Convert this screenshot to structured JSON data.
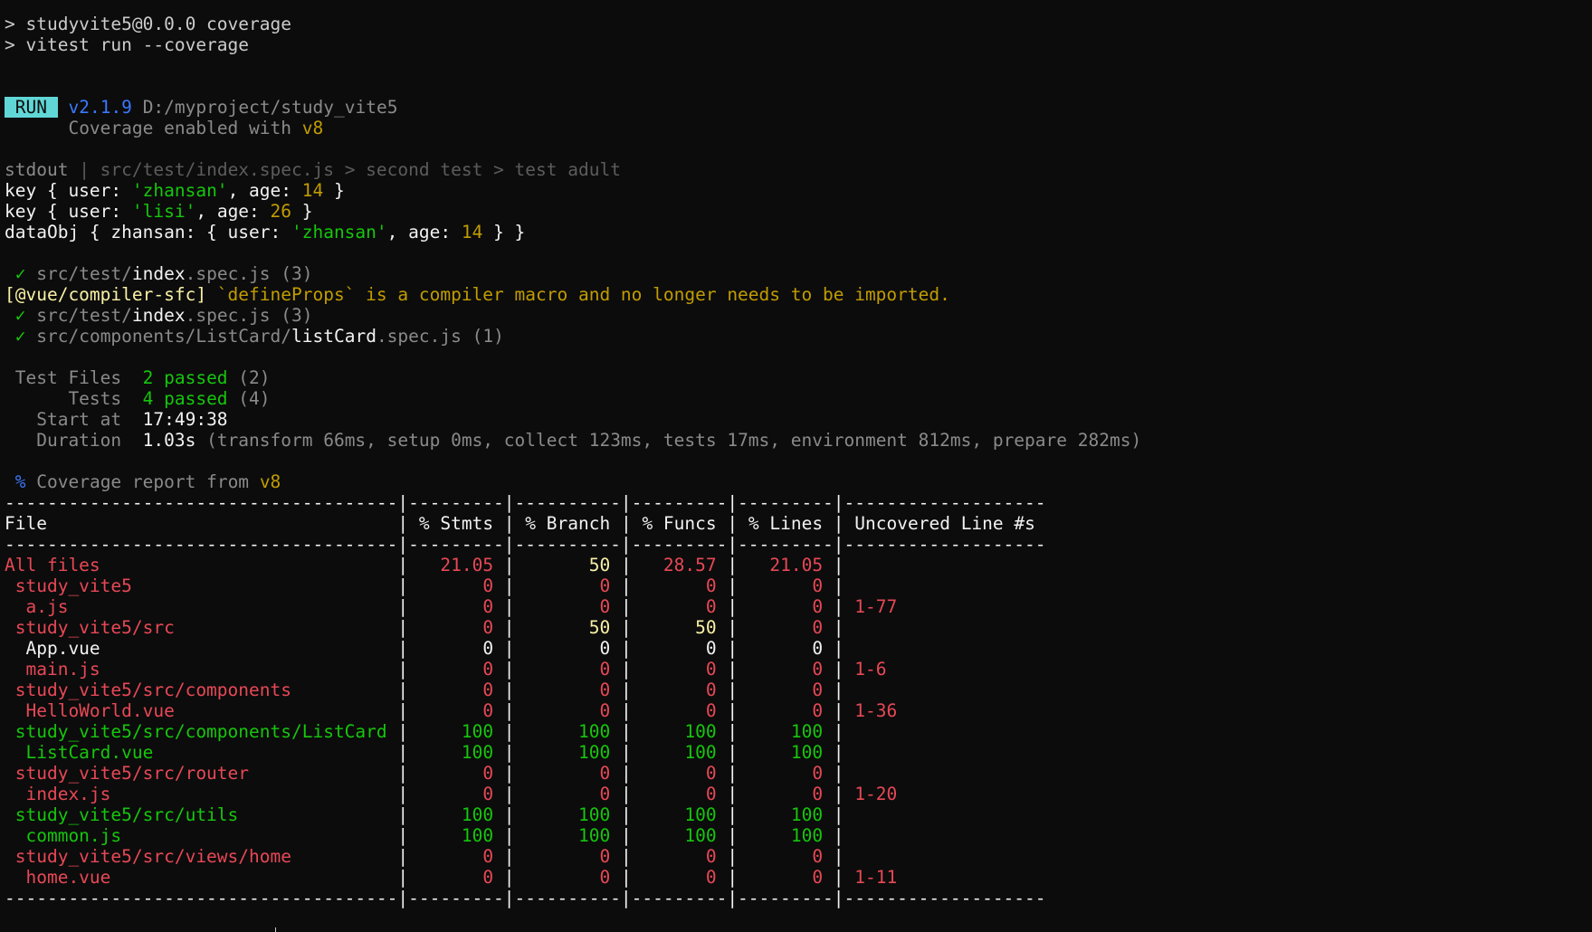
{
  "colors": {
    "background": "#0c0c0c",
    "default": "#cccccc",
    "red": "#e74856",
    "green": "#16c60c",
    "yellow": "#c19c00",
    "bright_yellow": "#f9f1a5",
    "blue": "#3b78ff",
    "badge": "#61d6d6"
  },
  "cmd": {
    "line1": "> studyvite5@0.0.0 coverage",
    "line2": "> vitest run --coverage"
  },
  "run": {
    "badge": "RUN",
    "version": "v2.1.9",
    "path": "D:/myproject/study_vite5",
    "coverage_text": "Coverage enabled with",
    "coverage_provider": "v8"
  },
  "stdout": {
    "label": "stdout",
    "path": "| src/test/index.spec.js > second test > test adult",
    "key1": {
      "prefix": "key { user: ",
      "str": "'zhansan'",
      "mid": ", age: ",
      "num": "14",
      "end": " }"
    },
    "key2": {
      "prefix": "key { user: ",
      "str": "'lisi'",
      "mid": ", age: ",
      "num": "26",
      "end": " }"
    },
    "obj": {
      "prefix": "dataObj { zhansan: { user: ",
      "str": "'zhansan'",
      "mid": ", age: ",
      "num": "14",
      "end": " } }"
    }
  },
  "checks": {
    "mark": "✓",
    "test1": {
      "dir": "src/test/",
      "name": "index",
      "ext": ".spec.js (3)"
    },
    "warn_prefix": "[@vue/compiler-sfc]",
    "warn_text": " `defineProps` is a compiler macro and no longer needs to be imported.",
    "test2": {
      "dir": "src/test/",
      "name": "index",
      "ext": ".spec.js (3)"
    },
    "test3": {
      "dir": "src/components/ListCard/",
      "name": "listCard",
      "ext": ".spec.js (1)"
    }
  },
  "summary": {
    "files_label": " Test Files  ",
    "files_passed": "2 passed",
    "files_total": " (2)",
    "tests_label": "      Tests  ",
    "tests_passed": "4 passed",
    "tests_total": " (4)",
    "start_label": "   Start at  ",
    "start_value": "17:49:38",
    "duration_label": "   Duration  ",
    "duration_value": "1.03s",
    "duration_detail": " (transform 66ms, setup 0ms, collect 123ms, tests 17ms, environment 812ms, prepare 282ms)"
  },
  "coverage": {
    "percent": "%",
    "title": "Coverage report from",
    "provider": "v8",
    "headers": [
      "File",
      "% Stmts",
      "% Branch",
      "% Funcs",
      "% Lines",
      "Uncovered Line #s"
    ],
    "rows": [
      {
        "file": "All files",
        "stmts": "21.05",
        "branch": "50",
        "funcs": "28.57",
        "lines": "21.05",
        "uncovered": ""
      },
      {
        "file": " study_vite5",
        "stmts": "0",
        "branch": "0",
        "funcs": "0",
        "lines": "0",
        "uncovered": ""
      },
      {
        "file": "  a.js",
        "stmts": "0",
        "branch": "0",
        "funcs": "0",
        "lines": "0",
        "uncovered": "1-77"
      },
      {
        "file": " study_vite5/src",
        "stmts": "0",
        "branch": "50",
        "funcs": "50",
        "lines": "0",
        "uncovered": ""
      },
      {
        "file": "  App.vue",
        "stmts": "0",
        "branch": "0",
        "funcs": "0",
        "lines": "0",
        "uncovered": ""
      },
      {
        "file": "  main.js",
        "stmts": "0",
        "branch": "0",
        "funcs": "0",
        "lines": "0",
        "uncovered": "1-6"
      },
      {
        "file": " study_vite5/src/components",
        "stmts": "0",
        "branch": "0",
        "funcs": "0",
        "lines": "0",
        "uncovered": ""
      },
      {
        "file": "  HelloWorld.vue",
        "stmts": "0",
        "branch": "0",
        "funcs": "0",
        "lines": "0",
        "uncovered": "1-36"
      },
      {
        "file": " study_vite5/src/components/ListCard",
        "stmts": "100",
        "branch": "100",
        "funcs": "100",
        "lines": "100",
        "uncovered": ""
      },
      {
        "file": "  ListCard.vue",
        "stmts": "100",
        "branch": "100",
        "funcs": "100",
        "lines": "100",
        "uncovered": ""
      },
      {
        "file": " study_vite5/src/router",
        "stmts": "0",
        "branch": "0",
        "funcs": "0",
        "lines": "0",
        "uncovered": ""
      },
      {
        "file": "  index.js",
        "stmts": "0",
        "branch": "0",
        "funcs": "0",
        "lines": "0",
        "uncovered": "1-20"
      },
      {
        "file": " study_vite5/src/utils",
        "stmts": "100",
        "branch": "100",
        "funcs": "100",
        "lines": "100",
        "uncovered": ""
      },
      {
        "file": "  common.js",
        "stmts": "100",
        "branch": "100",
        "funcs": "100",
        "lines": "100",
        "uncovered": ""
      },
      {
        "file": " study_vite5/src/views/home",
        "stmts": "0",
        "branch": "0",
        "funcs": "0",
        "lines": "0",
        "uncovered": ""
      },
      {
        "file": "  home.vue",
        "stmts": "0",
        "branch": "0",
        "funcs": "0",
        "lines": "0",
        "uncovered": "1-11"
      }
    ]
  }
}
